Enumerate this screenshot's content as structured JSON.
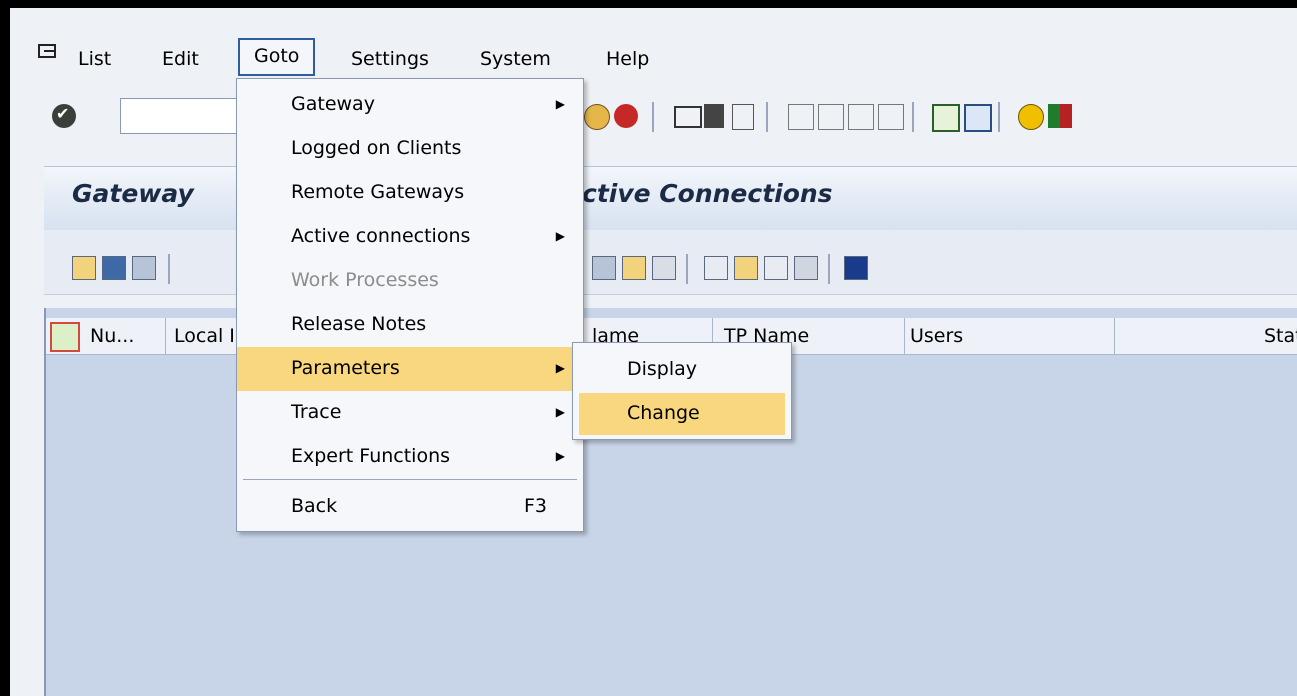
{
  "menubar": {
    "items": [
      "List",
      "Edit",
      "Goto",
      "Settings",
      "System",
      "Help"
    ]
  },
  "screen": {
    "title_left": "Gateway",
    "title_right": "ctive Connections"
  },
  "table": {
    "columns": [
      "Nu...",
      "Local I",
      "lame",
      "TP Name",
      "Users",
      "Stat"
    ]
  },
  "goto_menu": {
    "items": [
      {
        "label": "Gateway",
        "submenu": true
      },
      {
        "label": "Logged on Clients"
      },
      {
        "label": "Remote Gateways"
      },
      {
        "label": "Active connections",
        "submenu": true
      },
      {
        "label": "Work Processes",
        "disabled": true
      },
      {
        "label": "Release Notes"
      },
      {
        "label": "Parameters",
        "submenu": true,
        "highlighted": true
      },
      {
        "label": "Trace",
        "submenu": true
      },
      {
        "label": "Expert Functions",
        "submenu": true
      },
      {
        "label": "Back",
        "shortcut": "F3"
      }
    ]
  },
  "parameters_submenu": {
    "items": [
      {
        "label": "Display"
      },
      {
        "label": "Change",
        "highlighted": true
      }
    ]
  },
  "colors": {
    "highlight": "#f9d77e",
    "table_background": "#c8d5e8"
  }
}
